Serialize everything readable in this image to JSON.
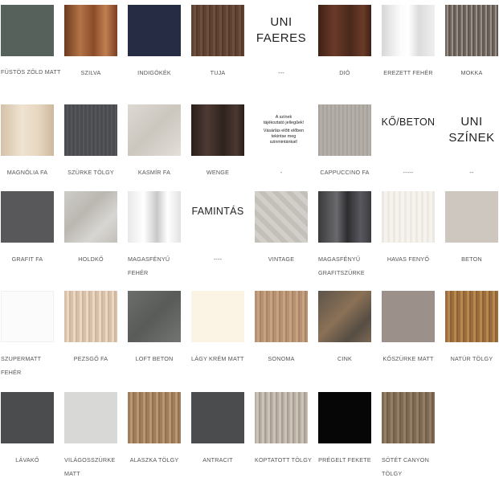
{
  "swatches": [
    {
      "label": "FÜSTÖS ZÖLD MATT",
      "texture": "smoky-green-matte",
      "color": "#56615c"
    },
    {
      "label": "SZILVA",
      "texture": "plum-wood",
      "color": "#a05f36"
    },
    {
      "label": "INDIGÓKÉK",
      "texture": "indigo-solid",
      "color": "#262c44"
    },
    {
      "label": "TUJA",
      "texture": "thuja-wood",
      "color": "#5e4332"
    },
    {
      "label": "---",
      "texture": "text-tile",
      "text_lines": [
        "UNI",
        "FAERES"
      ]
    },
    {
      "label": "DIÓ",
      "texture": "walnut-wood",
      "color": "#5a3020"
    },
    {
      "label": "EREZETT FEHÉR",
      "texture": "veined-white",
      "color": "#f2f2f2"
    },
    {
      "label": "MOKKA",
      "texture": "mocha-wood",
      "color": "#6e665d"
    },
    {
      "label": "MAGNÓLIA FA",
      "texture": "magnolia-wood",
      "color": "#e7d7c1"
    },
    {
      "label": "SZÜRKE TÖLGY",
      "texture": "grey-oak",
      "color": "#4b4c4f"
    },
    {
      "label": "KASMÍR FA",
      "texture": "cashmere-wood",
      "color": "#d8d4ce"
    },
    {
      "label": "WENGE",
      "texture": "wenge-wood",
      "color": "#3a2a24"
    },
    {
      "label": "-",
      "texture": "text-tile",
      "text_lines": [
        "A színek",
        "tájékoztató jellegűek!",
        "Vásárlás előtt előben",
        "tekintse meg",
        "szinmintánkat!"
      ]
    },
    {
      "label": "CAPPUCCINO FA",
      "texture": "cappuccino-wood",
      "color": "#aca7a0"
    },
    {
      "label": "-----",
      "texture": "text-tile",
      "text_lines": [
        "KŐ/BETON"
      ]
    },
    {
      "label": "--",
      "texture": "text-tile",
      "text_lines": [
        "UNI",
        "SZÍNEK"
      ]
    },
    {
      "label": "GRAFIT FA",
      "texture": "graphite-wood",
      "color": "#58585a"
    },
    {
      "label": "HOLDKŐ",
      "texture": "moonstone",
      "color": "#c8c5bf"
    },
    {
      "label": "MAGASFÉNYŰ FEHÉR",
      "texture": "high-gloss-white",
      "color": "#f0f0f0"
    },
    {
      "label": "----",
      "texture": "text-tile",
      "text_lines": [
        "FAMINTÁS"
      ]
    },
    {
      "label": "VINTAGE",
      "texture": "vintage-pattern",
      "color": "#c9c6c0"
    },
    {
      "label": "MAGASFÉNYŰ GRAFITSZÜRKE",
      "texture": "high-gloss-graphite",
      "color": "#4a4a4e"
    },
    {
      "label": "HAVAS FENYŐ",
      "texture": "snow-pine",
      "color": "#f1eee9"
    },
    {
      "label": "BETON",
      "texture": "concrete",
      "color": "#cdc7bf"
    },
    {
      "label": "SZUPERMATT FEHÉR",
      "texture": "super-matte-white",
      "color": "#fbfbfb"
    },
    {
      "label": "PEZSGŐ FA",
      "texture": "champagne-wood",
      "color": "#dcc6ae"
    },
    {
      "label": "LOFT BETON",
      "texture": "loft-concrete",
      "color": "#666865"
    },
    {
      "label": "LÁGY KRÉM MATT",
      "texture": "soft-cream-matte",
      "color": "#fbf4e4"
    },
    {
      "label": "SONOMA",
      "texture": "sonoma-oak",
      "color": "#b99576"
    },
    {
      "label": "CINK",
      "texture": "zinc",
      "color": "#6b5f52"
    },
    {
      "label": "KŐSZÜRKE MATT",
      "texture": "stone-grey-matte",
      "color": "#9b908a"
    },
    {
      "label": "NATÚR TÖLGY",
      "texture": "natural-oak",
      "color": "#a97b46"
    },
    {
      "label": "LÁVAKŐ",
      "texture": "lava-stone",
      "color": "#4b4c4d"
    },
    {
      "label": "VILÁGOSSZÜRKE MATT",
      "texture": "light-grey-matte",
      "color": "#d8d8d6"
    },
    {
      "label": "ALASZKA TÖLGY",
      "texture": "alaska-oak",
      "color": "#ad8966"
    },
    {
      "label": "ANTRACIT",
      "texture": "anthracite",
      "color": "#4b4c4e"
    },
    {
      "label": "KOPTATOTT TÖLGY",
      "texture": "distressed-oak",
      "color": "#bdb3a8"
    },
    {
      "label": "PRÉGELT FEKETE",
      "texture": "embossed-black",
      "color": "#060606"
    },
    {
      "label": "SÖTÉT CANYON TÖLGY",
      "texture": "dark-canyon-oak",
      "color": "#85705a"
    }
  ]
}
